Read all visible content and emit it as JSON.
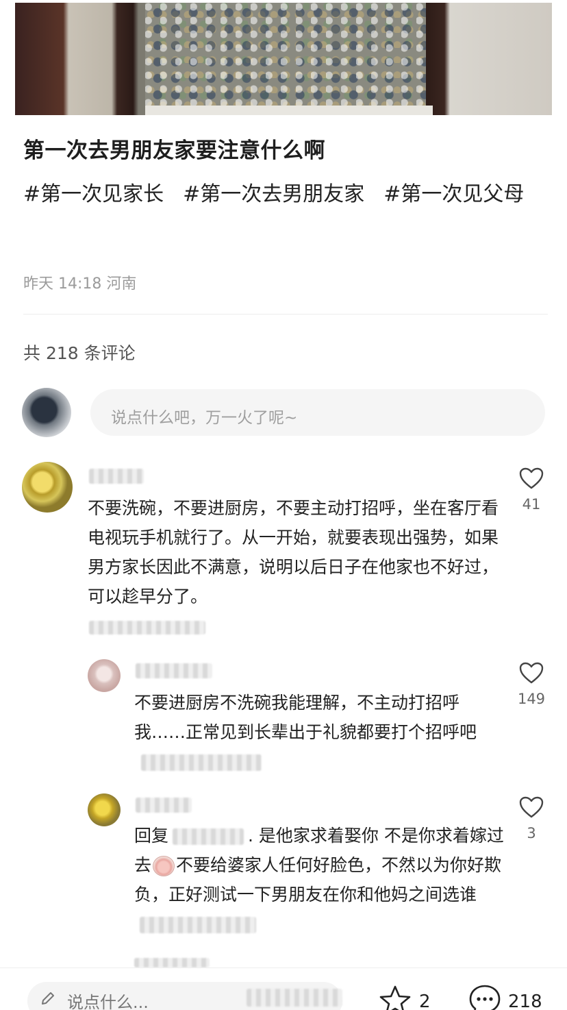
{
  "post": {
    "title": "第一次去男朋友家要注意什么啊",
    "tags": [
      "#第一次见家长",
      "#第一次去男朋友家",
      "#第一次见父母"
    ],
    "meta": "昨天 14:18 河南"
  },
  "comments_header": {
    "count_label": "共 218 条评论",
    "input_placeholder": "说点什么吧，万一火了呢~"
  },
  "comments": [
    {
      "text": "不要洗碗，不要进厨房，不要主动打招呼，坐在客厅看电视玩手机就行了。从一开始，就要表现出强势，如果男方家长因此不满意，说明以后日子在他家也不好过，可以趁早分了。",
      "likes": "41"
    },
    {
      "text": "不要进厨房不洗碗我能理解，不主动打招呼我……正常见到长辈出于礼貌都要打个招呼吧",
      "likes": "149"
    },
    {
      "reply_prefix": "回复",
      "text_a": ". 是他家求着娶你  不是你求着嫁过去",
      "text_b": "不要给婆家人任何好脸色，不然以为你好欺负，正好测试一下男朋友在你和他妈之间选谁",
      "likes": "3"
    }
  ],
  "bottom_bar": {
    "input_label": "说点什么...",
    "star_count": "2",
    "comment_count": "218"
  },
  "icons": {
    "like": "heart-icon",
    "star": "star-icon",
    "comment": "comment-bubble-icon",
    "pencil": "pencil-icon"
  }
}
